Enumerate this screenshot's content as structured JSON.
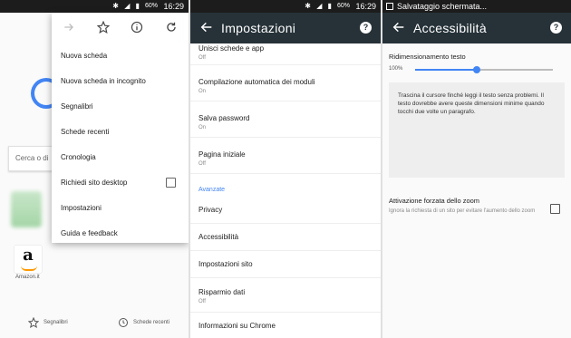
{
  "status": {
    "time": "16:29",
    "battery": "60%",
    "screenshot_label": "Salvataggio schermata..."
  },
  "browser": {
    "search_placeholder": "Cerca o di",
    "tile_label": "Amazon.it",
    "tile_letter": "a",
    "bottom_nav": {
      "bookmarks": "Segnalibri",
      "recent_tabs": "Schede recenti"
    }
  },
  "menu": {
    "items": [
      "Nuova scheda",
      "Nuova scheda in incognito",
      "Segnalibri",
      "Schede recenti",
      "Cronologia",
      "Richiedi sito desktop",
      "Impostazioni",
      "Guida e feedback"
    ],
    "desktop_checked": false
  },
  "settings": {
    "title": "Impostazioni",
    "items": [
      {
        "title": "Unisci schede e app",
        "sub": "Off"
      },
      {
        "title": "Compilazione automatica dei moduli",
        "sub": "On"
      },
      {
        "title": "Salva password",
        "sub": "On"
      },
      {
        "title": "Pagina iniziale",
        "sub": "Off"
      }
    ],
    "advanced_header": "Avanzate",
    "advanced": [
      {
        "title": "Privacy"
      },
      {
        "title": "Accessibilità"
      },
      {
        "title": "Impostazioni sito"
      },
      {
        "title": "Risparmio dati",
        "sub": "Off"
      },
      {
        "title": "Informazioni su Chrome"
      }
    ]
  },
  "accessibility": {
    "title": "Accessibilità",
    "text_scaling_label": "Ridimensionamento testo",
    "text_scaling_value": "100%",
    "text_scaling_fraction": 0.45,
    "preview_text": "Trascina il cursore finché leggi il testo senza problemi. Il testo dovrebbe avere queste dimensioni minime quando tocchi due volte un paragrafo.",
    "force_zoom_title": "Attivazione forzata dello zoom",
    "force_zoom_desc": "Ignora la richiesta di un sito per evitare l'aumento dello zoom",
    "force_zoom_checked": false
  },
  "colors": {
    "appbar": "#263238",
    "accent": "#4285f4",
    "statusbar": "#1c1c1c"
  }
}
